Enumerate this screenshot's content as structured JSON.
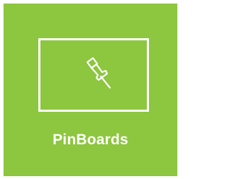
{
  "tile": {
    "label": "PinBoards",
    "icon": "pushpin-icon",
    "background_color": "#8dc63f",
    "foreground_color": "#ffffff"
  }
}
